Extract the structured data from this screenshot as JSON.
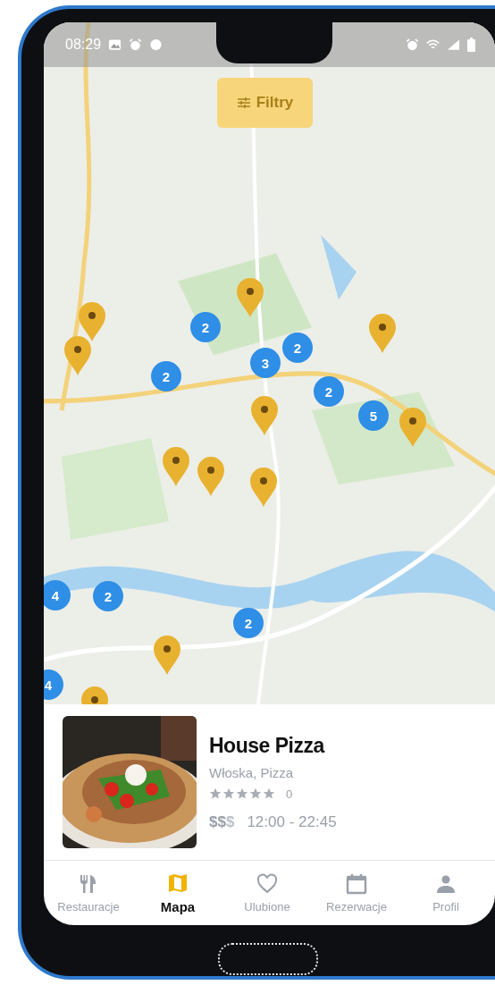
{
  "status_bar": {
    "time": "08:29"
  },
  "filter_button": {
    "label": "Filtry"
  },
  "map": {
    "markers": [
      {
        "kind": "pin"
      },
      {
        "kind": "pin"
      },
      {
        "kind": "pin"
      },
      {
        "kind": "pin"
      },
      {
        "kind": "pin"
      },
      {
        "kind": "pin"
      },
      {
        "kind": "pin"
      },
      {
        "kind": "pin"
      },
      {
        "kind": "pin"
      },
      {
        "kind": "pin"
      },
      {
        "kind": "pin"
      },
      {
        "kind": "cluster",
        "count": "2"
      },
      {
        "kind": "cluster",
        "count": "2"
      },
      {
        "kind": "cluster",
        "count": "3"
      },
      {
        "kind": "cluster",
        "count": "2"
      },
      {
        "kind": "cluster",
        "count": "2"
      },
      {
        "kind": "cluster",
        "count": "5"
      },
      {
        "kind": "cluster",
        "count": "4"
      },
      {
        "kind": "cluster",
        "count": "2"
      },
      {
        "kind": "cluster",
        "count": "2"
      },
      {
        "kind": "cluster",
        "count": "4"
      }
    ]
  },
  "restaurant_card": {
    "name": "House Pizza",
    "cuisine": "Włoska, Pizza",
    "stars": 0,
    "rating_count": "0",
    "price": {
      "active": "$$",
      "inactive": "$"
    },
    "hours": "12:00 - 22:45"
  },
  "tabs": [
    {
      "label": "Restauracje",
      "selected": false
    },
    {
      "label": "Mapa",
      "selected": true
    },
    {
      "label": "Ulubione",
      "selected": false
    },
    {
      "label": "Rezerwacje",
      "selected": false
    },
    {
      "label": "Profil",
      "selected": false
    }
  ]
}
